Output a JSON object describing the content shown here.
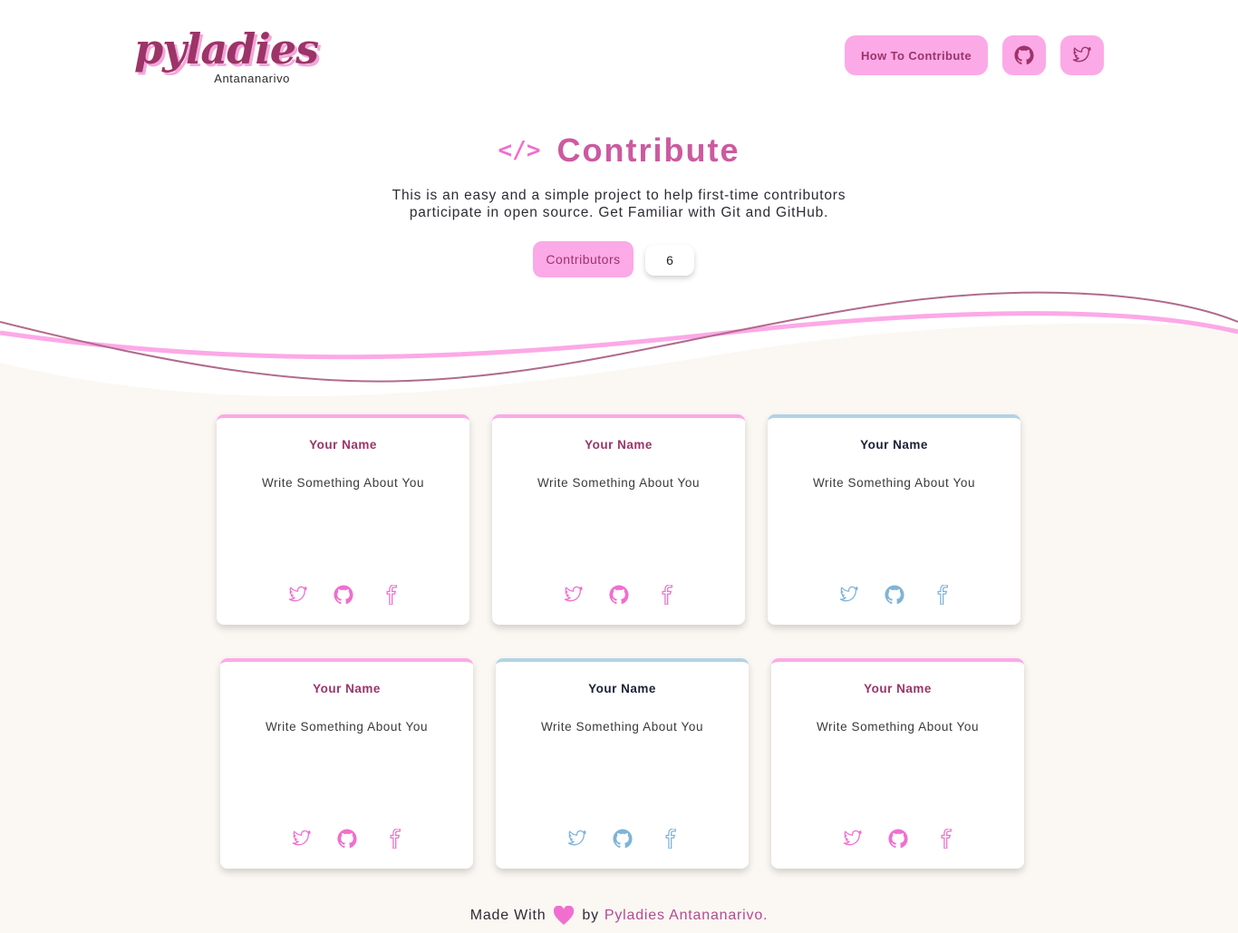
{
  "brand": {
    "logo_word": "pyladies",
    "logo_sub": "Antananarivo"
  },
  "nav": {
    "how_to_contribute": "How To Contribute",
    "github_icon": "github-icon",
    "twitter_icon": "twitter-icon"
  },
  "hero": {
    "code_symbol": "</>",
    "title": "Contribute",
    "description_line1": "This is an easy and a simple project to help first-time contributors",
    "description_line2": "participate in open source. Get Familiar with Git and GitHub.",
    "contributors_label": "Contributors",
    "contributors_count": "6"
  },
  "cards": [
    {
      "name": "Your Name",
      "about": "Write Something About You",
      "theme": "pink"
    },
    {
      "name": "Your Name",
      "about": "Write Something About You",
      "theme": "pink"
    },
    {
      "name": "Your Name",
      "about": "Write Something About You",
      "theme": "blue"
    },
    {
      "name": "Your Name",
      "about": "Write Something About You",
      "theme": "pink"
    },
    {
      "name": "Your Name",
      "about": "Write Something About You",
      "theme": "blue"
    },
    {
      "name": "Your Name",
      "about": "Write Something About You",
      "theme": "pink"
    }
  ],
  "footer": {
    "made_with": "Made With",
    "by": "by",
    "org": "Pyladies Antananarivo."
  },
  "colors": {
    "brand_pink": "#fca9e7",
    "brand_dark": "#9c3468",
    "accent_blue": "#b2d3e4",
    "icon_blue": "#7fb4d6",
    "background_cream": "#fbf7f3"
  }
}
